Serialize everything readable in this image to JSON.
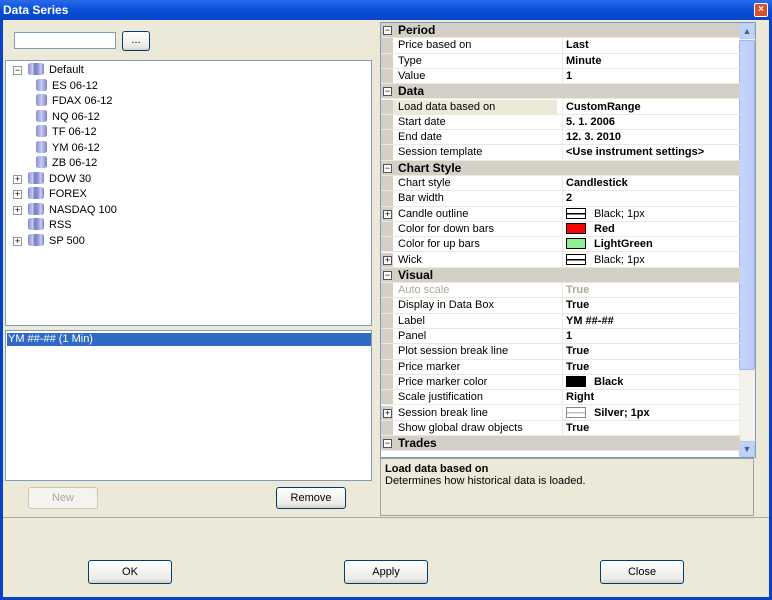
{
  "window": {
    "title": "Data Series",
    "close_glyph": "×"
  },
  "search": {
    "value": "",
    "browse_label": "..."
  },
  "tree": [
    {
      "label": "Default",
      "level": 0,
      "expander": "−",
      "group": true
    },
    {
      "label": "ES 06-12",
      "level": 1
    },
    {
      "label": "FDAX 06-12",
      "level": 1
    },
    {
      "label": "NQ 06-12",
      "level": 1
    },
    {
      "label": "TF 06-12",
      "level": 1
    },
    {
      "label": "YM 06-12",
      "level": 1
    },
    {
      "label": "ZB 06-12",
      "level": 1
    },
    {
      "label": "DOW 30",
      "level": 0,
      "expander": "+",
      "group": true
    },
    {
      "label": "FOREX",
      "level": 0,
      "expander": "+",
      "group": true
    },
    {
      "label": "NASDAQ 100",
      "level": 0,
      "expander": "+",
      "group": true
    },
    {
      "label": "RSS",
      "level": 0,
      "group": true
    },
    {
      "label": "SP 500",
      "level": 0,
      "expander": "+",
      "group": true
    }
  ],
  "series_list": {
    "items": [
      "YM ##-## (1 Min)"
    ]
  },
  "buttons": {
    "new": "New",
    "remove": "Remove",
    "ok": "OK",
    "apply": "Apply",
    "close": "Close"
  },
  "properties": [
    {
      "category": "Period",
      "rows": [
        {
          "name": "Price based on",
          "value": "Last"
        },
        {
          "name": "Type",
          "value": "Minute"
        },
        {
          "name": "Value",
          "value": "1"
        }
      ]
    },
    {
      "category": "Data",
      "rows": [
        {
          "name": "Load data based on",
          "value": "CustomRange",
          "selected": true
        },
        {
          "name": "Start date",
          "value": "5. 1. 2006"
        },
        {
          "name": "End date",
          "value": "12. 3. 2010"
        },
        {
          "name": "Session template",
          "value": "<Use instrument settings>"
        }
      ]
    },
    {
      "category": "Chart Style",
      "rows": [
        {
          "name": "Chart style",
          "value": "Candlestick"
        },
        {
          "name": "Bar width",
          "value": "2"
        },
        {
          "name": "Candle outline",
          "value": "Black; 1px",
          "swatch": "line",
          "expandable": true,
          "normal": true
        },
        {
          "name": "Color for down bars",
          "value": "Red",
          "color": "#FF0000"
        },
        {
          "name": "Color for up bars",
          "value": "LightGreen",
          "color": "#90EE90"
        },
        {
          "name": "Wick",
          "value": "Black; 1px",
          "swatch": "line",
          "expandable": true,
          "normal": true
        }
      ]
    },
    {
      "category": "Visual",
      "rows": [
        {
          "name": "Auto scale",
          "value": "True",
          "disabled": true
        },
        {
          "name": "Display in Data Box",
          "value": "True"
        },
        {
          "name": "Label",
          "value": "YM ##-##"
        },
        {
          "name": "Panel",
          "value": "1"
        },
        {
          "name": "Plot session break line",
          "value": "True"
        },
        {
          "name": "Price marker",
          "value": "True"
        },
        {
          "name": "Price marker color",
          "value": "Black",
          "color": "#000000"
        },
        {
          "name": "Scale justification",
          "value": "Right"
        },
        {
          "name": "Session break line",
          "value": "Silver; 1px",
          "swatch": "silver",
          "expandable": true
        },
        {
          "name": "Show global draw objects",
          "value": "True"
        }
      ]
    },
    {
      "category": "Trades",
      "rows": []
    }
  ],
  "help": {
    "title": "Load data based on",
    "text": "Determines how historical data is loaded."
  }
}
